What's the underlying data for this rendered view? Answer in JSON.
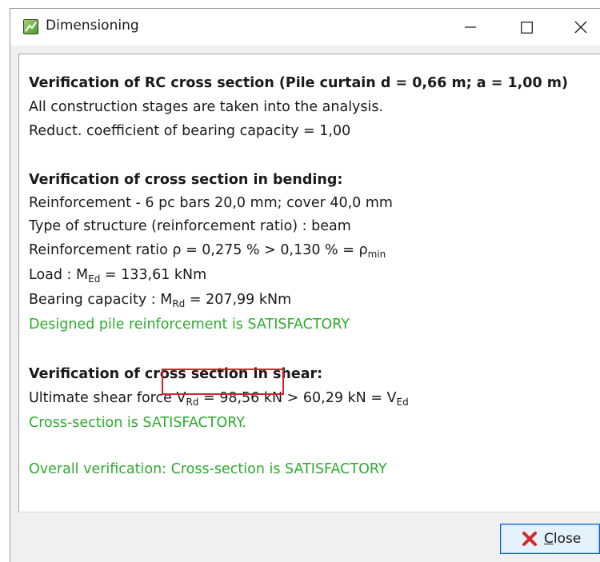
{
  "window": {
    "title": "Dimensioning"
  },
  "content": {
    "heading": "Verification of RC cross section (Pile curtain d = 0,66 m; a = 1,00 m)",
    "stages": "All construction stages are taken into the analysis.",
    "reduct": "Reduct. coefficient of bearing capacity = 1,00",
    "bending": {
      "heading": "Verification of cross section in bending:",
      "reinforcement": "Reinforcement - 6 pc bars 20,0 mm; cover 40,0 mm",
      "structure_type": "Type of structure (reinforcement ratio) : beam",
      "ratio_prefix": "Reinforcement ratio ρ = 0,275 % > 0,130 % = ρ",
      "ratio_sub": "min",
      "load_prefix": "Load : M",
      "load_sub": "Ed",
      "load_value": " = 133,61 kNm",
      "capacity_prefix": "Bearing capacity : M",
      "capacity_sub": "Rd",
      "capacity_value": " = 207,99 kNm",
      "result": "Designed pile reinforcement is SATISFACTORY"
    },
    "shear": {
      "heading": "Verification of cross section in shear:",
      "label": "Ultimate shear force ",
      "v_symbol": "V",
      "v_sub": "Rd",
      "v_value": " = 98,56 kN ",
      "comparison": "> 60,29 kN = V",
      "comparison_sub": "Ed",
      "result": "Cross-section is SATISFACTORY."
    },
    "overall": "Overall verification: Cross-section is SATISFACTORY"
  },
  "buttons": {
    "close_label": "Close",
    "close_mnemonic": "C",
    "close_rest": "lose"
  },
  "colors": {
    "success_green": "#2eaa2e",
    "highlight_red": "#d9202b",
    "close_icon_red": "#d62828"
  }
}
